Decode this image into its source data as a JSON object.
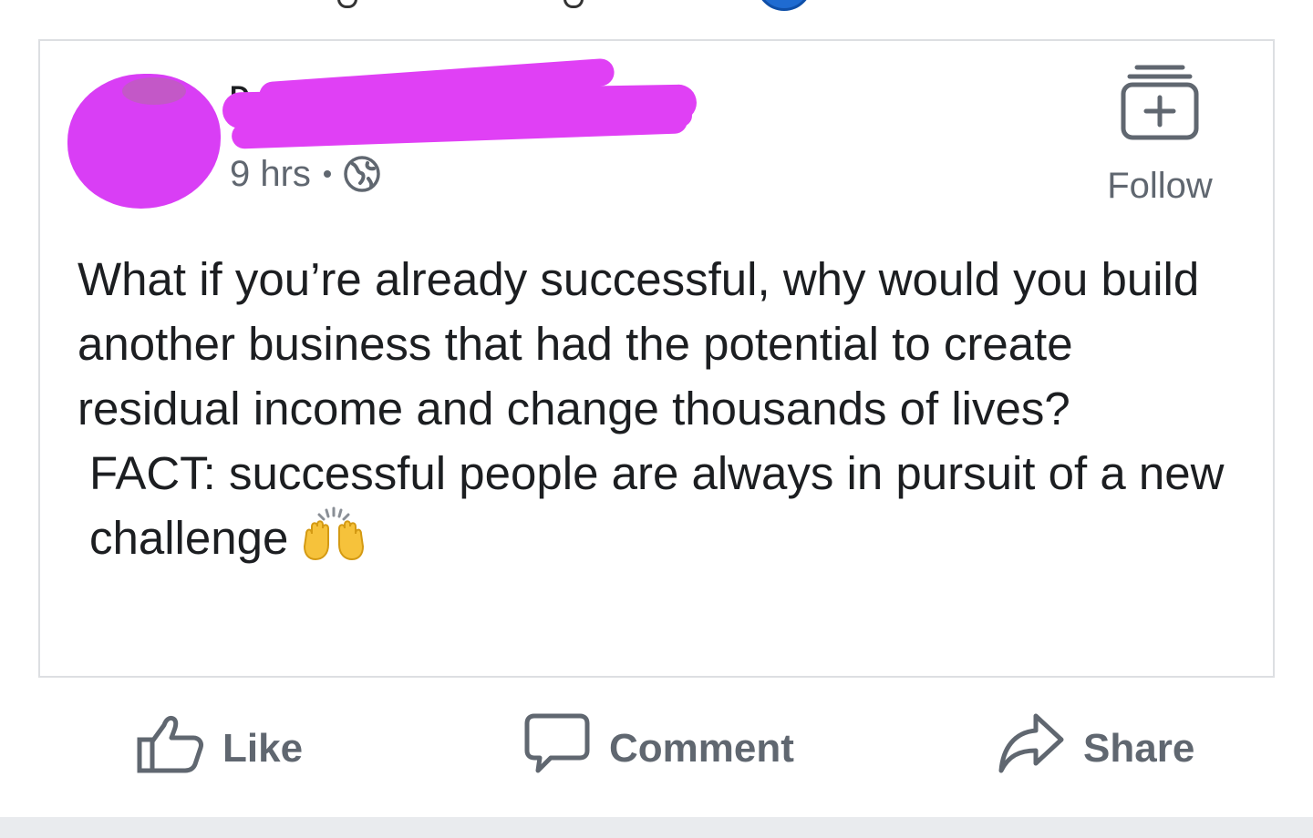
{
  "post": {
    "author_initial": "D",
    "time": "9 hrs",
    "visibility_icon": "globe-icon",
    "follow_label": "Follow",
    "follow_icon": "follow-add-icon",
    "text_lines": [
      "What if you’re already successful, why would you build another business that had the potential to create residual income and change thousands of lives?",
      "FACT: successful people are always in pursuit of a new challenge"
    ],
    "emoji": "raising-hands-icon"
  },
  "actions": {
    "like": "Like",
    "comment": "Comment",
    "share": "Share"
  },
  "colors": {
    "text": "#1c1e21",
    "secondary": "#606770",
    "scribble": "#e040f5",
    "border": "#dddfe2",
    "divider": "#e9ebee"
  }
}
